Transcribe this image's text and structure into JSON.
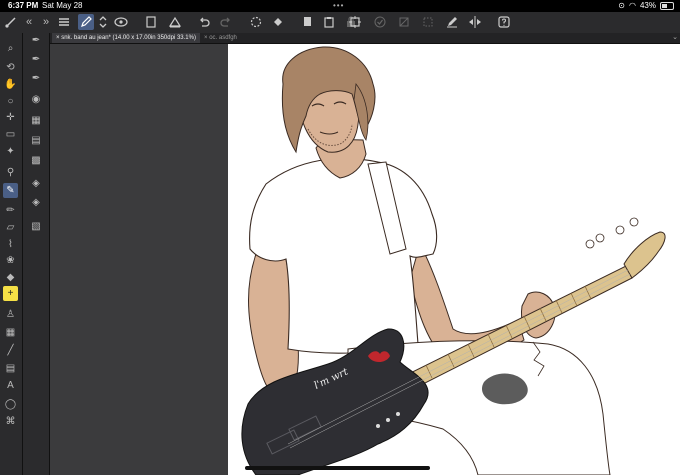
{
  "status_bar": {
    "time": "6:37 PM",
    "date": "Sat May 28",
    "multitask_dots": "•••",
    "battery_percent": "43%"
  },
  "tabs": [
    {
      "label": "snk. band au jean* (14.00 x 17.00in 350dpi 33.1%)",
      "close": "×",
      "active": true
    },
    {
      "label": "oc. asdfgh",
      "close": "×",
      "active": false
    }
  ],
  "artwork": {
    "guitar_inscription": "l'm wrt"
  },
  "colors": {
    "toolbar": "#2b2b2d",
    "accent": "#4a5f86",
    "highlight_tool": "#f5e046",
    "canvas": "#ffffff",
    "workspace": "#3b3b3d"
  }
}
